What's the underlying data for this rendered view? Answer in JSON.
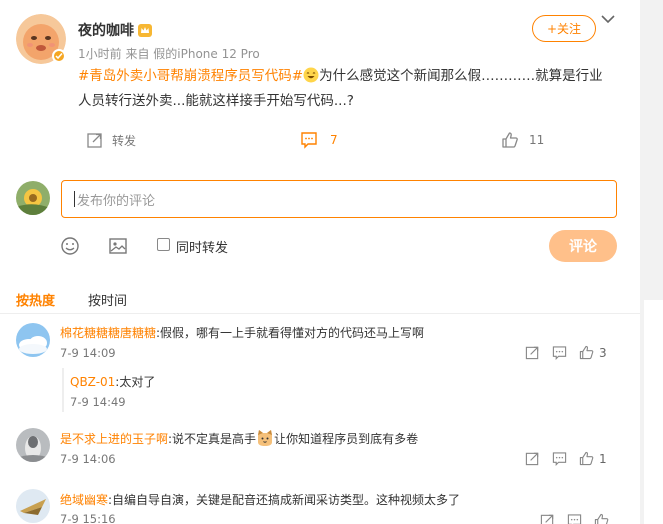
{
  "post": {
    "author_name": "夜的咖啡",
    "meta": "1小时前  来自 假的iPhone 12 Pro",
    "follow_label": "+关注",
    "hashtag": "#青岛外卖小哥帮崩溃程序员写代码#",
    "body_line1": "为什么感觉这个新闻那么假…………就算是行业",
    "body_line2": "人员转行送外卖...能就这样接手开始写代码...?",
    "repost_label": "转发",
    "comment_count": "7",
    "like_count": "11"
  },
  "composer": {
    "placeholder": "发布你的评论",
    "repost_checkbox_label": "同时转发",
    "submit_label": "评论"
  },
  "sort_tabs": {
    "hot": "按热度",
    "time": "按时间"
  },
  "comments": [
    {
      "user": "棉花糖糖糖唐糖糖",
      "text": ":假假，哪有一上手就看得懂对方的代码还马上写啊",
      "time": "7-9 14:09",
      "likes": "3",
      "reply": {
        "user": "QBZ-01",
        "text": ":太对了",
        "time": "7-9 14:49"
      }
    },
    {
      "user": "是不求上进的玉子啊",
      "text_before": ":说不定真是高手",
      "text_after": "让你知道程序员到底有多卷",
      "time": "7-9 14:06",
      "likes": "1"
    },
    {
      "user": "绝域幽寒",
      "text": ":自编自导自演，关键是配音还搞成新闻采访类型。这种视频太多了",
      "time": "7-9 15:16"
    }
  ],
  "colors": {
    "accent": "#ff8200",
    "submit_disabled": "#ffc08a",
    "muted_text": "#939393"
  },
  "icons": [
    "verified-badge-icon",
    "crown-icon",
    "chevron-down-icon",
    "repost-icon",
    "comment-icon",
    "like-icon",
    "emoji-icon",
    "image-icon",
    "share-icon"
  ]
}
